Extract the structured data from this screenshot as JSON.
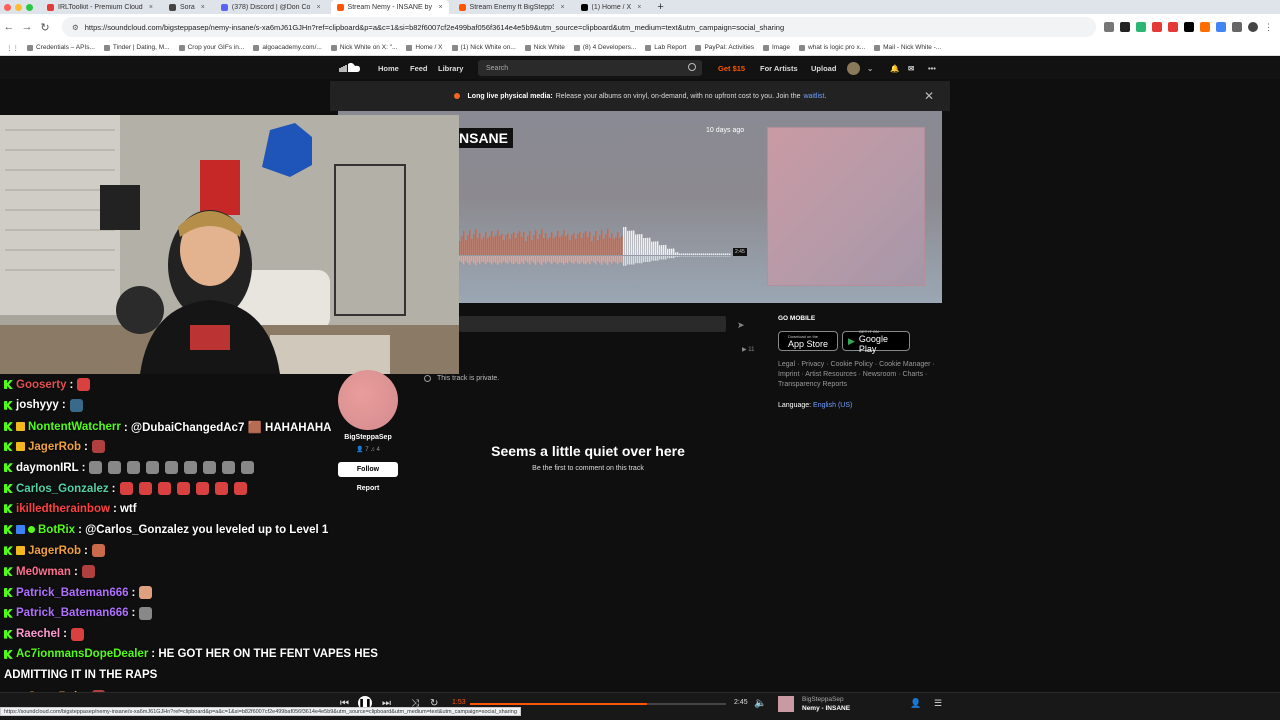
{
  "browser": {
    "tabs": [
      {
        "label": "IRLToolkit - Premium Cloud S",
        "fav": "#e53935"
      },
      {
        "label": "Sora",
        "fav": "#444"
      },
      {
        "label": "(378) Discord | @Don Co",
        "fav": "#5865f2"
      },
      {
        "label": "Stream Nemy - INSANE by B",
        "fav": "#f50",
        "active": true
      },
      {
        "label": "Stream Enemy ft BigSteppSe",
        "fav": "#f50"
      },
      {
        "label": "(1) Home / X",
        "fav": "#000"
      }
    ],
    "new_tab": "+",
    "url": "https://soundcloud.com/bigsteppasep/nemy-insane/s-xa6mJ61GJHn?ref=clipboard&p=a&c=1&si=b82f6007cf2e499baf056f3614e4e5b9&utm_source=clipboard&utm_medium=text&utm_campaign=social_sharing",
    "bookmarks": [
      "Credentials – APIs...",
      "Tinder | Dating, M...",
      "Crop your GIFs in...",
      "algoacademy.com/...",
      "Nick White on X: \"...",
      "Home / X",
      "(1) Nick White on...",
      "Nick White",
      "(8) 4 Developers...",
      "Lab Report",
      "PayPal: Activities",
      "Image",
      "what is logic pro x...",
      "Mail - Nick White -..."
    ],
    "status_url": "https://soundcloud.com/bigsteppasep/nemy-insane/s-xa6mJ61GJHn?ref=clipboard&p=a&c=1&si=b82f6007cf2e499baf056f3614e4e5b9&utm_source=clipboard&utm_medium=text&utm_campaign=social_sharing"
  },
  "soundcloud": {
    "nav": {
      "home": "Home",
      "feed": "Feed",
      "library": "Library",
      "search_placeholder": "Search",
      "get15": "Get $15",
      "for_artists": "For Artists",
      "upload": "Upload"
    },
    "banner": {
      "bold": "Long live physical media:",
      "text": "Release your albums on vinyl, on-demand, with no upfront cost to you. Join the",
      "link": "waitlist",
      "end": "."
    },
    "track": {
      "title": "NSANE",
      "date": "10 days ago",
      "duration_tag": "2:45",
      "plays": "▶ 11"
    },
    "private_notice": "This track is private.",
    "artist": {
      "name": "BigSteppaSep",
      "stats": "👤 7   ♫ 4",
      "follow": "Follow",
      "report": "Report"
    },
    "empty": {
      "title": "Seems a little quiet over here",
      "subtitle": "Be the first to comment on this track"
    },
    "sidebar": {
      "go_mobile": "GO MOBILE",
      "app_store_small": "Download on the",
      "app_store": "App Store",
      "google_small": "GET IT ON",
      "google": "Google Play",
      "links": "Legal · Privacy · Cookie Policy · Cookie Manager · Imprint · Artist Resources · Newsroom · Charts · Transparency Reports",
      "language_label": "Language:",
      "language_value": "English (US)"
    },
    "player": {
      "current": "1:53",
      "total": "2:45",
      "progress": 0.69,
      "artist": "BigSteppaSep",
      "track": "Nemy - INSANE"
    }
  },
  "chat": [
    {
      "user": "Gooserty",
      "color": "#e05050",
      "msg": ":",
      "badges": [
        "k"
      ],
      "emotes": 1
    },
    {
      "user": "joshyyy",
      "color": "#ffffff",
      "msg": ":",
      "badges": [
        "k"
      ],
      "emotes": 1
    },
    {
      "user": "NontentWatcherr",
      "color": "#53fc18",
      "msg": ": @DubaiChangedAc7 🟫 HAHAHAHA",
      "badges": [
        "k",
        "crown"
      ],
      "emotes": 0
    },
    {
      "user": "JagerRob",
      "color": "#f0a040",
      "msg": ":",
      "badges": [
        "k",
        "crown"
      ],
      "emotes": 1
    },
    {
      "user": "daymonIRL",
      "color": "#ffffff",
      "msg": ":",
      "badges": [
        "k"
      ],
      "emotes": 9
    },
    {
      "user": "Carlos_Gonzalez",
      "color": "#53d0a8",
      "msg": ":",
      "badges": [
        "k"
      ],
      "emotes": 7
    },
    {
      "user": "ikilledtherainbow",
      "color": "#ff4040",
      "msg": ": wtf",
      "badges": [
        "k"
      ],
      "emotes": 0
    },
    {
      "user": "BotRix",
      "color": "#53fc18",
      "msg": ": @Carlos_Gonzalez you leveled up to Level 1",
      "badges": [
        "k",
        "blue",
        "check"
      ],
      "emotes": 0
    },
    {
      "user": "JagerRob",
      "color": "#f0a040",
      "msg": ":",
      "badges": [
        "k",
        "crown"
      ],
      "emotes": 1
    },
    {
      "user": "Me0wman",
      "color": "#ff7090",
      "msg": ":",
      "badges": [
        "k"
      ],
      "emotes": 1
    },
    {
      "user": "Patrick_Bateman666",
      "color": "#b070ff",
      "msg": ":",
      "badges": [
        "k"
      ],
      "emotes": 1
    },
    {
      "user": "Patrick_Bateman666",
      "color": "#b070ff",
      "msg": ":",
      "badges": [
        "k"
      ],
      "emotes": 1
    },
    {
      "user": "Raechel",
      "color": "#ff9ad0",
      "msg": ":",
      "badges": [
        "k"
      ],
      "emotes": 1
    },
    {
      "user": "Ac7ionmansDopeDealer",
      "color": "#53fc18",
      "msg": ": HE GOT HER ON THE FENT VAPES HES",
      "badges": [
        "k"
      ],
      "emotes": 0
    },
    {
      "user": "",
      "color": "#ffffff",
      "msg": "ADMITTING IT IN THE RAPS",
      "badges": [],
      "emotes": 0
    },
    {
      "user": "JagerRob",
      "color": "#f0a040",
      "msg": ":",
      "badges": [
        "k",
        "crown"
      ],
      "emotes": 1
    }
  ]
}
